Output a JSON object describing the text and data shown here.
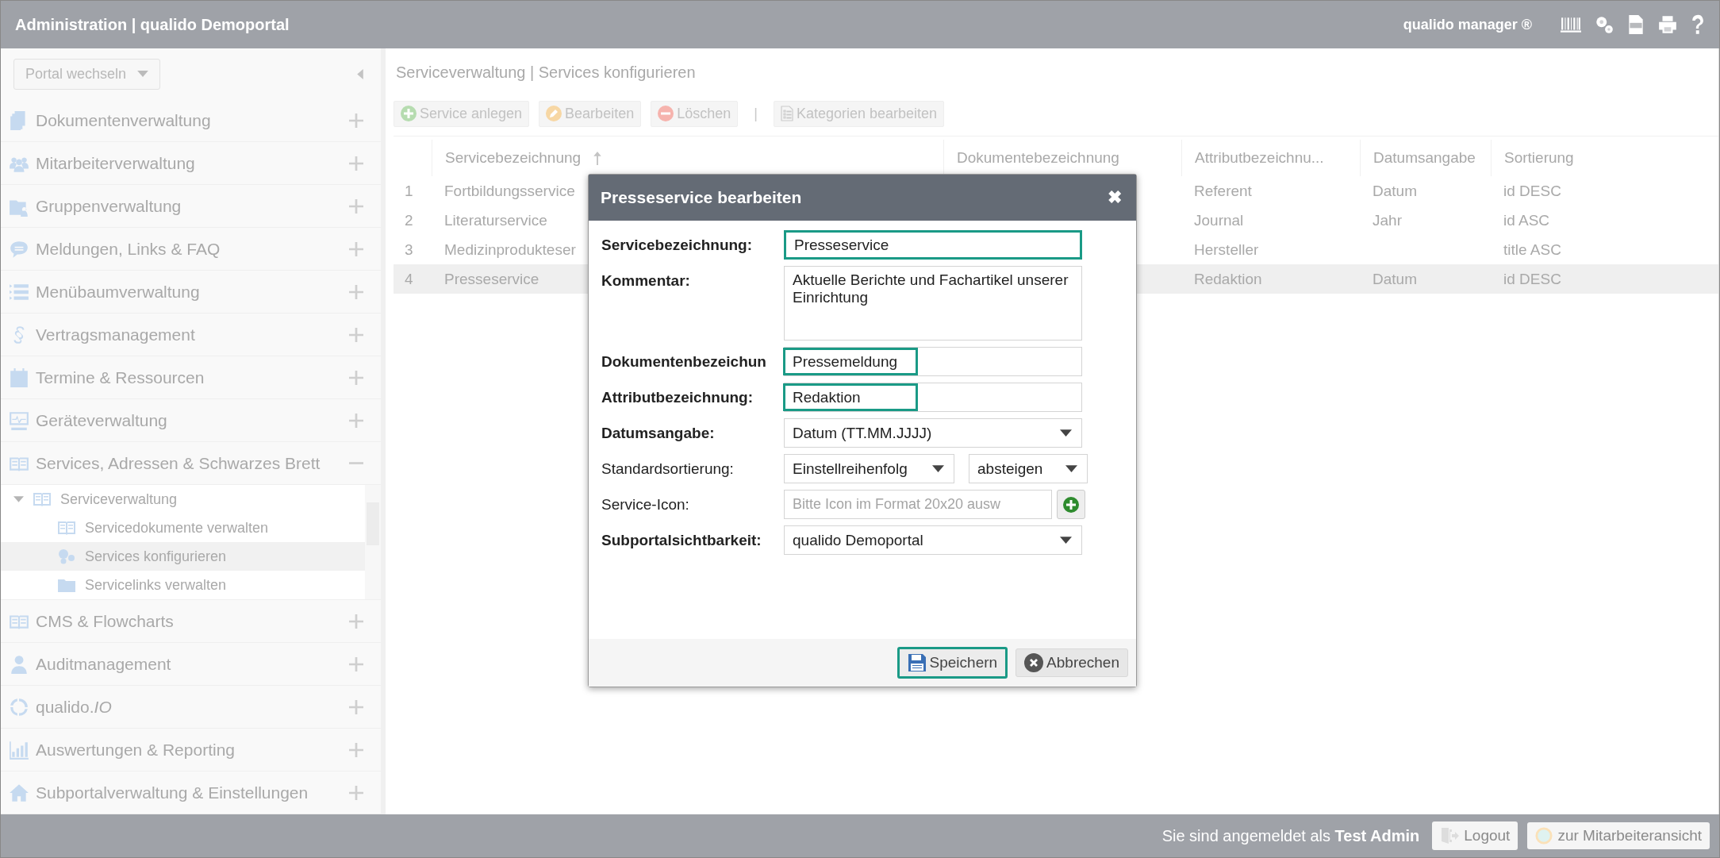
{
  "header": {
    "title": "Administration | qualido Demoportal",
    "product": "qualido manager ®"
  },
  "sidebar": {
    "portal_select": "Portal wechseln",
    "items": [
      {
        "label": "Dokumentenverwaltung",
        "expanded": false
      },
      {
        "label": "Mitarbeiterverwaltung",
        "expanded": false
      },
      {
        "label": "Gruppenverwaltung",
        "expanded": false
      },
      {
        "label": "Meldungen, Links & FAQ",
        "expanded": false
      },
      {
        "label": "Menübaumverwaltung",
        "expanded": false
      },
      {
        "label": "Vertragsmanagement",
        "expanded": false
      },
      {
        "label": "Termine & Ressourcen",
        "expanded": false
      },
      {
        "label": "Geräteverwaltung",
        "expanded": false
      },
      {
        "label": "Services, Adressen & Schwarzes Brett",
        "expanded": true,
        "children": [
          {
            "label": "Serviceverwaltung",
            "expanded": true,
            "children": [
              {
                "label": "Servicedokumente verwalten",
                "selected": false
              },
              {
                "label": "Services konfigurieren",
                "selected": true
              },
              {
                "label": "Servicelinks verwalten",
                "selected": false
              }
            ]
          }
        ]
      },
      {
        "label": "CMS & Flowcharts",
        "expanded": false
      },
      {
        "label": "Auditmanagement",
        "expanded": false
      },
      {
        "label": "qualido.*IO*",
        "expanded": false
      },
      {
        "label": "Auswertungen & Reporting",
        "expanded": false
      },
      {
        "label": "Subportalverwaltung & Einstellungen",
        "expanded": false
      }
    ]
  },
  "main": {
    "title": "Serviceverwaltung | Services konfigurieren",
    "toolbar": [
      {
        "kind": "add",
        "label": "Service anlegen"
      },
      {
        "kind": "edit",
        "label": "Bearbeiten"
      },
      {
        "kind": "delete",
        "label": "Löschen"
      },
      {
        "kind": "separator",
        "label": "|"
      },
      {
        "kind": "categories",
        "label": "Kategorien bearbeiten"
      }
    ],
    "table": {
      "columns": [
        {
          "label": "Servicebezeichnung",
          "sorted": true
        },
        {
          "label": "Dokumentebezeichnung",
          "sorted": false
        },
        {
          "label": "Attributbezeichnu...",
          "sorted": false
        },
        {
          "label": "Datumsangabe",
          "sorted": false
        },
        {
          "label": "Sortierung",
          "sorted": false
        }
      ],
      "rows": [
        {
          "index": "1",
          "name": "Fortbildungsservice",
          "attribute": "Referent",
          "date": "Datum",
          "sort": "id DESC",
          "selected": false
        },
        {
          "index": "2",
          "name": "Literaturservice",
          "attribute": "Journal",
          "date": "Jahr",
          "sort": "id ASC",
          "selected": false
        },
        {
          "index": "3",
          "name": "Medizinprodukteser",
          "attribute": "Hersteller",
          "sort": "title ASC",
          "selected": false
        },
        {
          "index": "4",
          "name": "Presseservice",
          "attribute": "Redaktion",
          "date": "Datum",
          "sort": "id DESC",
          "selected": true
        }
      ]
    }
  },
  "dialog": {
    "title": "Presseservice bearbeiten",
    "close": "✖",
    "fields": [
      {
        "kind": "text",
        "label": "Servicebezeichnung:",
        "bold": true,
        "value": "Presseservice",
        "highlighted": true
      },
      {
        "kind": "textarea",
        "label": "Kommentar:",
        "bold": true,
        "value": "Aktuelle Berichte und Fachartikel unserer Einrichtung"
      },
      {
        "kind": "text",
        "label": "Dokumentenbezeichun",
        "bold": true,
        "value": "Pressemeldung",
        "highlighted": true
      },
      {
        "kind": "text",
        "label": "Attributbezeichnung:",
        "bold": true,
        "value": "Redaktion",
        "highlighted": true
      },
      {
        "kind": "select",
        "label": "Datumsangabe:",
        "bold": true,
        "value": "Datum (TT.MM.JJJJ)"
      },
      {
        "kind": "select-pair",
        "label": "Standardsortierung:",
        "bold": false,
        "values": [
          "Einstellreihenfolg",
          "absteigen"
        ]
      },
      {
        "kind": "file",
        "label": "Service-Icon:",
        "bold": false,
        "placeholder": "Bitte Icon im Format 20x20 ausw"
      },
      {
        "kind": "select",
        "label": "Subportalsichtbarkeit:",
        "bold": true,
        "value": "qualido Demoportal"
      }
    ],
    "buttons": [
      {
        "kind": "save",
        "label": "Speichern",
        "highlighted": true
      },
      {
        "kind": "cancel",
        "label": "Abbrechen",
        "highlighted": false
      }
    ]
  },
  "footer": {
    "login_text": "Sie sind angemeldet als **Test Admin**",
    "buttons": [
      {
        "kind": "logout",
        "label": "Logout"
      },
      {
        "kind": "staff-view",
        "label": "zur Mitarbeiteransicht"
      }
    ]
  }
}
